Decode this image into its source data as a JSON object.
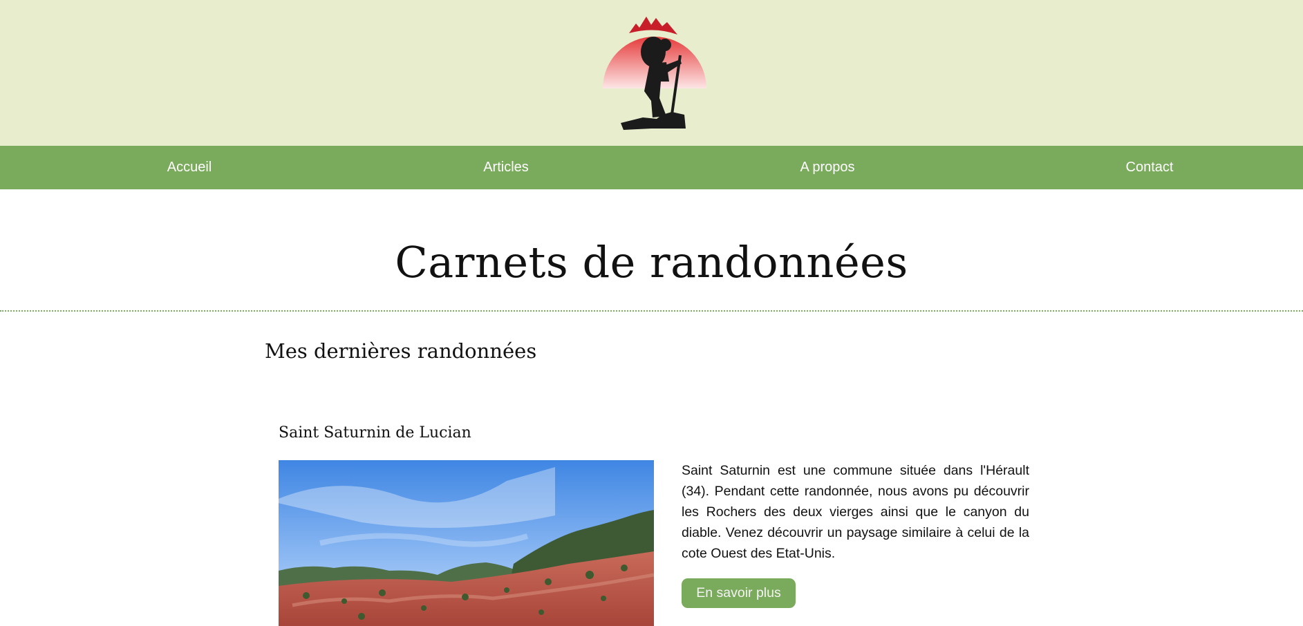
{
  "header": {
    "logo_icon": "hiker-silhouette-logo",
    "banner_color": "#e8eecd"
  },
  "nav": {
    "color": "#7aaa5c",
    "items": [
      {
        "label": "Accueil"
      },
      {
        "label": "Articles"
      },
      {
        "label": "A propos"
      },
      {
        "label": "Contact"
      }
    ]
  },
  "main": {
    "title": "Carnets de randonnées",
    "section_title": "Mes dernières randonnées"
  },
  "articles": [
    {
      "title": "Saint Saturnin de Lucian",
      "description": "Saint Saturnin est une commune située dans l'Hérault (34). Pendant cette randonnée, nous avons pu découvrir les Rochers des deux vierges ainsi que le canyon du diable. Venez découvrir un paysage similaire à celui de la cote Ouest des Etat-Unis.",
      "button_label": "En savoir plus",
      "image_subject": "red-clay-landscape-photo"
    }
  ]
}
